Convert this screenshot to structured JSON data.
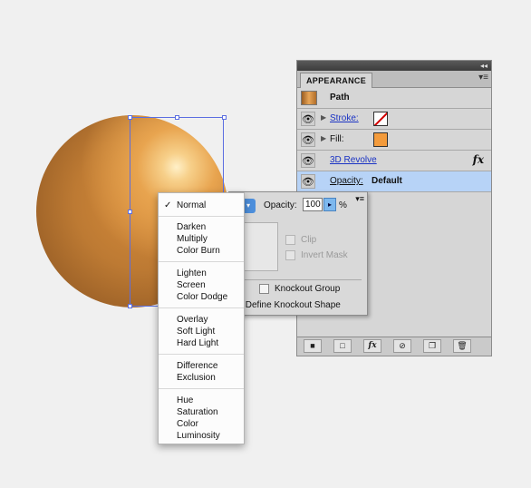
{
  "appearance_panel": {
    "tab_label": "APPEARANCE",
    "rows": {
      "path_label": "Path",
      "stroke_label": "Stroke:",
      "fill_label": "Fill:",
      "effect_label": "3D Revolve",
      "opacity_label": "Opacity:",
      "opacity_value": "Default"
    }
  },
  "transparency_panel": {
    "opacity_label": "Opacity:",
    "opacity_value": "100",
    "percent": "%",
    "clip_label": "Clip",
    "invert_mask_label": "Invert Mask",
    "isolate_partial": "g",
    "knockout_group_label": "Knockout Group",
    "define_knockout_partial": "k Define Knockout Shape"
  },
  "blend_menu": {
    "checkmark": "✓",
    "items": [
      "Normal",
      "Darken",
      "Multiply",
      "Color Burn",
      "Lighten",
      "Screen",
      "Color Dodge",
      "Overlay",
      "Soft Light",
      "Hard Light",
      "Difference",
      "Exclusion",
      "Hue",
      "Saturation",
      "Color",
      "Luminosity"
    ],
    "selected": "Normal"
  },
  "colors": {
    "fill": "#f39b3c",
    "selection": "#5b6ee1",
    "highlight_row": "#b7d3f7"
  }
}
